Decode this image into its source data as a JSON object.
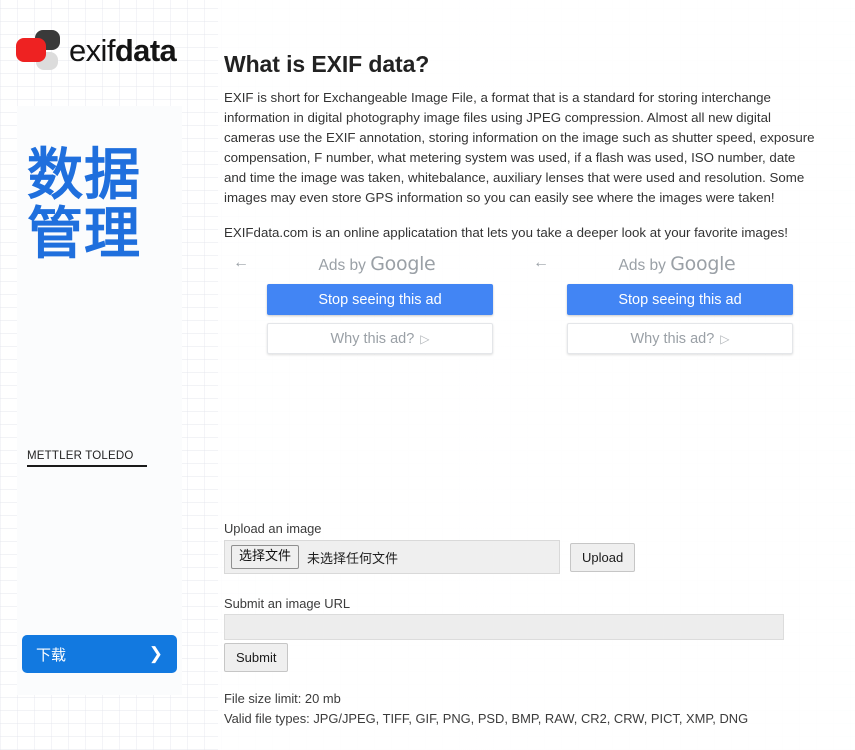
{
  "site": {
    "logo_text_light": "exif",
    "logo_text_bold": "data"
  },
  "sidebar_ad": {
    "adchoices_glyph": "▷",
    "close_glyph": "✕",
    "ghost_text": "METTLER TOLEDO",
    "headline": "数据管理",
    "brand": "METTLER TOLEDO",
    "cta_label": "下载",
    "cta_arrow": "❯"
  },
  "main": {
    "title": "What is EXIF data?",
    "paragraph_1": "EXIF is short for Exchangeable Image File, a format that is a standard for storing interchange information in digital photography image files using JPEG compression. Almost all new digital cameras use the EXIF annotation, storing information on the image such as shutter speed, exposure compensation, F number, what metering system was used, if a flash was used, ISO number, date and time the image was taken, whitebalance, auxiliary lenses that were used and resolution. Some images may even store GPS information so you can easily see where the images were taken!",
    "paragraph_2": "EXIFdata.com is an online applicatation that lets you take a deeper look at your favorite images!"
  },
  "google_ads": [
    {
      "back_arrow": "←",
      "by_prefix": "Ads by ",
      "by_brand": "Google",
      "stop_label": "Stop seeing this ad",
      "why_label": "Why this ad?",
      "why_glyph": "▷"
    },
    {
      "back_arrow": "←",
      "by_prefix": "Ads by ",
      "by_brand": "Google",
      "stop_label": "Stop seeing this ad",
      "why_label": "Why this ad?",
      "why_glyph": "▷"
    }
  ],
  "form": {
    "upload_label": "Upload an image",
    "choose_file_button": "选择文件",
    "no_file_text": "未选择任何文件",
    "upload_button": "Upload",
    "url_label": "Submit an image URL",
    "url_value": "",
    "url_placeholder": "",
    "submit_button": "Submit",
    "file_size_limit": "File size limit: 20 mb",
    "valid_types": "Valid file types: JPG/JPEG, TIFF, GIF, PNG, PSD, BMP, RAW, CR2, CRW, PICT, XMP, DNG"
  },
  "colors": {
    "google_blue": "#4285F4",
    "ad_cta_blue": "#1279E0",
    "headline_blue": "#1F6FDD",
    "logo_red": "#EE2222",
    "adchoices_teal": "#2AA6C4"
  }
}
